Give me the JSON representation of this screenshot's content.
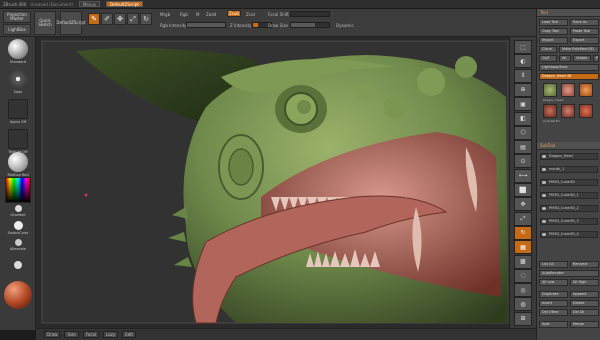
{
  "titlebar": {
    "app_title": "ZBrush 4R6",
    "readout": "Unsaved (Document)",
    "menu_buttons": [
      "Menus",
      "DefaultZScript"
    ],
    "active_index": 1
  },
  "topbar": {
    "projection_master": "Projection Master",
    "lightbox": "LightBox",
    "quick_sketch": "Quick Sketch",
    "edit_icon": "pencil-icon",
    "draw_icon": "brush-icon",
    "move": "Move",
    "scale": "Scale",
    "rotate": "Rotate",
    "mrgb": "Mrgb",
    "rgb": "Rgb",
    "m": "M",
    "zadd": "Zadd",
    "zsub": "Zsub",
    "zcut": "Zcut",
    "focal_shift_label": "Focal Shift",
    "focal_shift_value": 0,
    "draw_size_label": "Draw Size",
    "draw_size_value": 64,
    "z_intensity_label": "Z Intensity",
    "z_intensity_value": 25,
    "rgb_intensity_label": "Rgb Intensity",
    "rgb_intensity_value": 100,
    "dynamic_label": "Dynamic"
  },
  "left_tray": {
    "tools": [
      {
        "label": "Standard",
        "color": "#cfcfcf"
      },
      {
        "label": "Dots",
        "color": "#cfcfcf"
      },
      {
        "label": "Alpha Off",
        "color": "#3a3a3a"
      },
      {
        "label": "Texture Off",
        "color": "#3a3a3a"
      },
      {
        "label": "MatCap Red Wax",
        "color": "#bdbdbd"
      }
    ],
    "gradient_label": "Gradient",
    "switch_color_label": "SwitchColor",
    "alternate_label": "Alternate",
    "material_label": "Material",
    "material_color": "#b34a26"
  },
  "right_shelf": {
    "buttons": [
      "BPR",
      "SPix",
      "Scroll",
      "Zoom",
      "Actual",
      "AAHalf",
      "Persp",
      "Floor",
      "Local",
      "LSym",
      "Frame",
      "Move",
      "Scale",
      "Rotate",
      "Line Fill",
      "PolyF",
      "Transp",
      "Ghost",
      "Solo",
      "Xpose"
    ],
    "active_indices": [
      13,
      14
    ]
  },
  "right_panel": {
    "tool_header": "Tool",
    "load_tool": "Load Tool",
    "save_as": "Save As",
    "copy_tool": "Copy Tool",
    "paste_tool": "Paste Tool",
    "import": "Import",
    "export": "Export",
    "clone": "Clone",
    "make_polymesh": "Make PolyMesh3D",
    "goz": "GoZ",
    "all": "All",
    "visible": "Visible",
    "r": "R",
    "lightbox_tools": "Lightbox▸Tools",
    "current_tool": "Dragon_Head 48",
    "thumbs": [
      {
        "name": "Dragon_Head",
        "color": "#8a9a5a"
      },
      {
        "name": "SimpleBrush",
        "color": "#c07a6a"
      },
      {
        "name": "Dragon_Head",
        "color": "#c66a16"
      },
      {
        "name": "Cylinder3D",
        "color": "#a05040"
      },
      {
        "name": "PM3D_Cube3D",
        "color": "#b05a4a"
      },
      {
        "name": "Polymesh3D",
        "color": "#c0503a"
      }
    ],
    "subtool_header": "SubTool",
    "subtools": [
      "Dragon_Head",
      "mouth_1",
      "PM3D_Cube3D",
      "PM3D_Cube3D_1",
      "PM3D_Cube3D_2",
      "PM3D_Cube3D_3",
      "PM3D_Cube3D_4"
    ],
    "list_all": "List All",
    "rename": "Rename",
    "autoreorder": "AutoReorder",
    "all_low": "All Low",
    "all_high": "All High",
    "duplicate": "Duplicate",
    "append": "Append",
    "insert": "Insert",
    "delete": "Delete",
    "del_other": "Del Other",
    "del_all": "Del All",
    "split": "Split",
    "merge": "Merge"
  },
  "bottom_bar": {
    "buttons": [
      "Draw",
      "Size",
      "Focal",
      "Lazy",
      "Edit"
    ]
  },
  "colors": {
    "skin": "#6f8a4b",
    "mouth": "#b56a5f",
    "accent": "#c66a16"
  }
}
